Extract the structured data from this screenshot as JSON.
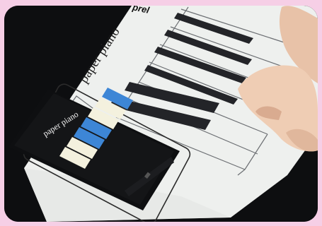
{
  "scene": {
    "paper_label": "paper piano",
    "paper_brand": "prel",
    "phone_label": "paper piano"
  },
  "colors": {
    "frame_border": "#f6cfe6",
    "paper": "#f2f3f1",
    "black_key": "#222326",
    "phone_body": "#111214",
    "phone_key": "#f4f1de",
    "phone_key_pressed": "#3d86d6"
  }
}
